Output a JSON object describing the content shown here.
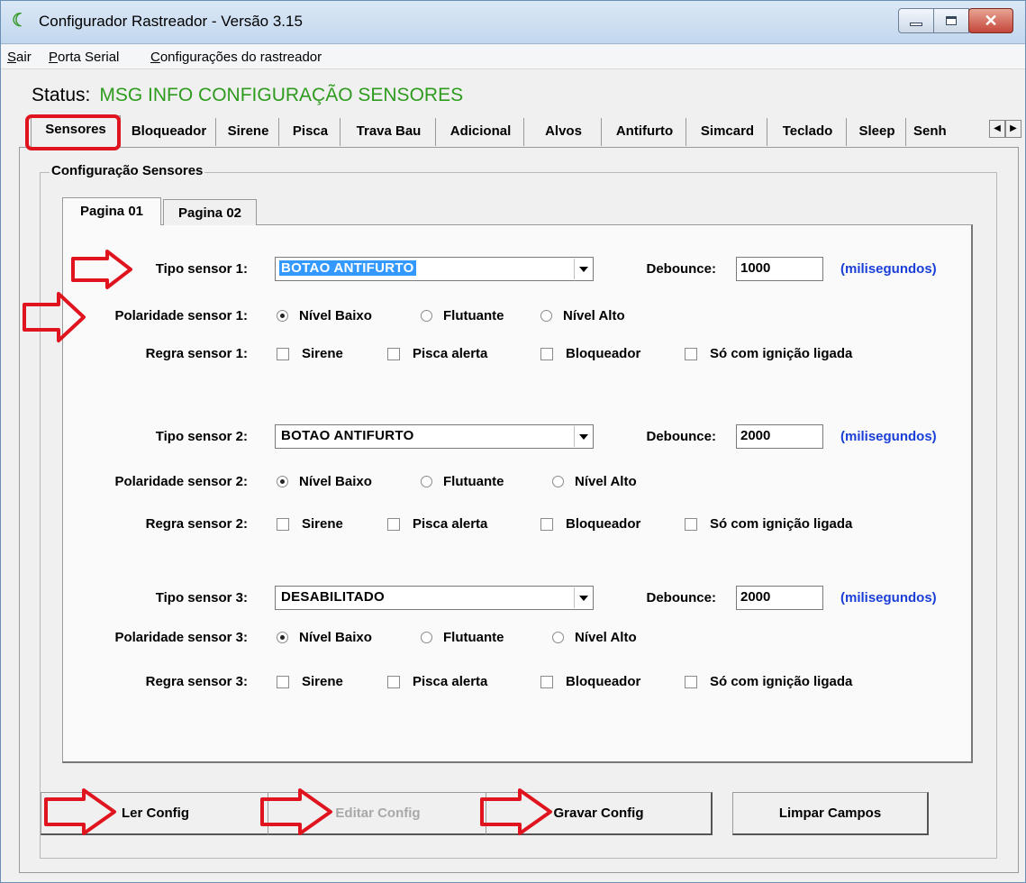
{
  "window": {
    "title": "Configurador Rastreador - Versão 3.15",
    "app_icon": "app-logo-icon"
  },
  "menu": {
    "items": [
      {
        "first": "S",
        "rest": "air"
      },
      {
        "first": "P",
        "rest": "orta Serial"
      },
      {
        "first": "C",
        "rest": "onfigurações do rastreador"
      }
    ]
  },
  "status": {
    "label": "Status:",
    "value": "MSG INFO CONFIGURAÇÃO SENSORES",
    "value_color": "#2e9b1e"
  },
  "tabs": [
    {
      "label": "Sensores",
      "active": true
    },
    {
      "label": "Bloqueador"
    },
    {
      "label": "Sirene"
    },
    {
      "label": "Pisca"
    },
    {
      "label": "Trava Bau"
    },
    {
      "label": "Adicional"
    },
    {
      "label": "Alvos"
    },
    {
      "label": "Antifurto"
    },
    {
      "label": "Simcard"
    },
    {
      "label": "Teclado"
    },
    {
      "label": "Sleep"
    },
    {
      "label": "Senh"
    }
  ],
  "group": {
    "title": "Configuração Sensores",
    "subtabs": [
      {
        "label": "Pagina 01",
        "active": true
      },
      {
        "label": "Pagina 02"
      }
    ]
  },
  "sensors": [
    {
      "tipo_label": "Tipo sensor 1:",
      "tipo_value": "BOTAO ANTIFURTO",
      "debounce_label": "Debounce:",
      "debounce_value": "1000",
      "unit": "(milisegundos)",
      "polaridade_label": "Polaridade sensor 1:",
      "polaridade_options": [
        "Nível Baixo",
        "Flutuante",
        "Nível Alto"
      ],
      "polaridade_selected": 0,
      "regra_label": "Regra sensor 1:",
      "regra_options": [
        "Sirene",
        "Pisca alerta",
        "Bloqueador",
        "Só com ignição ligada"
      ]
    },
    {
      "tipo_label": "Tipo sensor 2:",
      "tipo_value": "BOTAO ANTIFURTO",
      "debounce_label": "Debounce:",
      "debounce_value": "2000",
      "unit": "(milisegundos)",
      "polaridade_label": "Polaridade sensor 2:",
      "polaridade_options": [
        "Nível Baixo",
        "Flutuante",
        "Nível Alto"
      ],
      "polaridade_selected": 0,
      "regra_label": "Regra sensor 2:",
      "regra_options": [
        "Sirene",
        "Pisca alerta",
        "Bloqueador",
        "Só com ignição ligada"
      ]
    },
    {
      "tipo_label": "Tipo sensor 3:",
      "tipo_value": "DESABILITADO",
      "debounce_label": "Debounce:",
      "debounce_value": "2000",
      "unit": "(milisegundos)",
      "polaridade_label": "Polaridade sensor 3:",
      "polaridade_options": [
        "Nível Baixo",
        "Flutuante",
        "Nível Alto"
      ],
      "polaridade_selected": 0,
      "regra_label": "Regra sensor 3:",
      "regra_options": [
        "Sirene",
        "Pisca alerta",
        "Bloqueador",
        "Só com ignição ligada"
      ]
    }
  ],
  "buttons": {
    "ler": "Ler Config",
    "editar": "Editar Config",
    "gravar": "Gravar Config",
    "limpar": "Limpar Campos"
  },
  "annotations": {
    "color": "#e0141e"
  }
}
